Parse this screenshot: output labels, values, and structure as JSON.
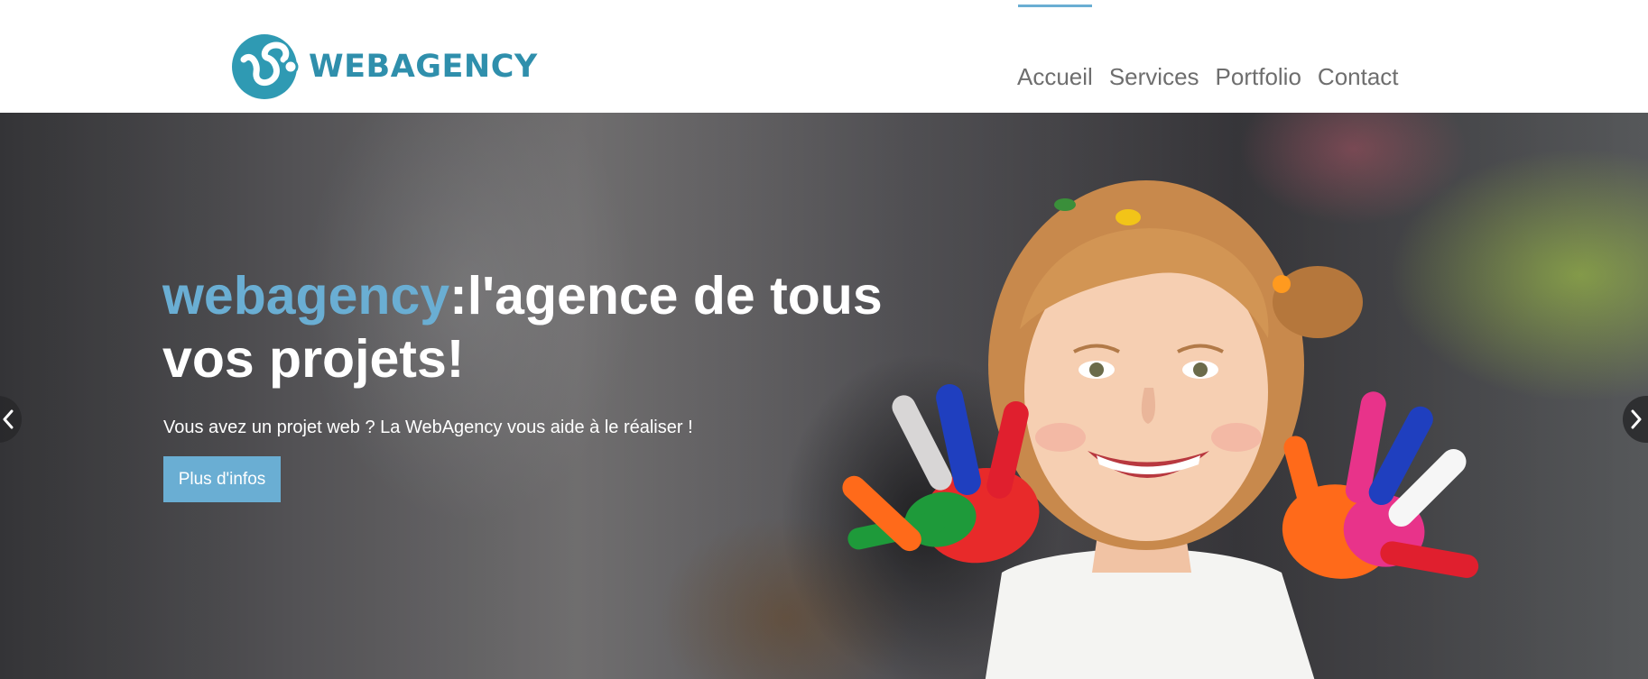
{
  "header": {
    "logo": {
      "text": "WEBAGENCY",
      "icon": "webagency-logo-mark",
      "color": "#2f8fac"
    },
    "nav": {
      "items": [
        {
          "label": "Accueil",
          "active": true
        },
        {
          "label": "Services",
          "active": false
        },
        {
          "label": "Portfolio",
          "active": false
        },
        {
          "label": "Contact",
          "active": false
        }
      ],
      "active_indicator_color": "#6aaed3",
      "text_color": "#6e6e6e"
    }
  },
  "hero": {
    "title_brand": "webagency",
    "title_rest": ":l'agence de tous vos projets!",
    "subtitle": "Vous avez un projet web ? La WebAgency vous aide à le réaliser !",
    "cta_label": "Plus d'infos",
    "accent_color": "#6aaed3",
    "image": "smiling-child-painted-hands-photo",
    "prev_icon": "chevron-left-icon",
    "next_icon": "chevron-right-icon"
  }
}
